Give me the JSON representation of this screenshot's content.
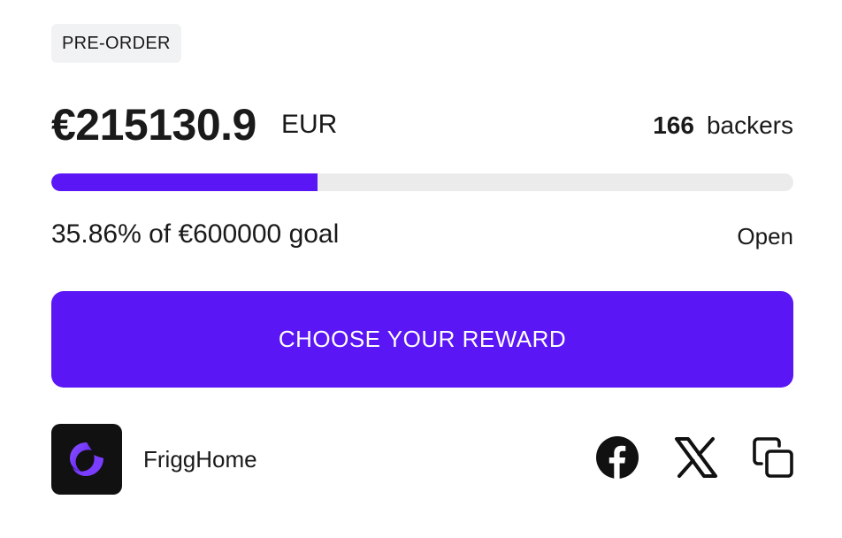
{
  "badge": {
    "label": "PRE-ORDER"
  },
  "funding": {
    "amount": "€215130.9",
    "currency": "EUR",
    "backers_count": "166",
    "backers_label": "backers",
    "progress_fraction": 0.3586,
    "goal_text": "35.86% of €600000 goal",
    "status": "Open"
  },
  "cta": {
    "label": "CHOOSE YOUR REWARD"
  },
  "project": {
    "name": "FriggHome"
  },
  "share": {
    "icons": [
      "facebook-icon",
      "x-icon",
      "copy-icon"
    ]
  },
  "colors": {
    "accent": "#5a16f4",
    "progress_track": "#ebebeb",
    "badge_bg": "#f1f2f4",
    "logo_bg": "#111111"
  }
}
